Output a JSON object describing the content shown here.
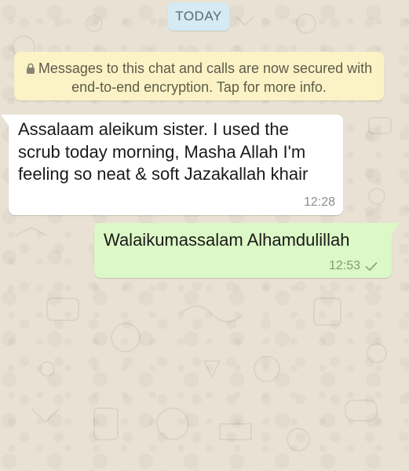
{
  "chat": {
    "date_label": "TODAY",
    "system_message": "Messages to this chat and calls are now secured with end-to-end encryption. Tap for more info.",
    "messages": [
      {
        "direction": "incoming",
        "text": "Assalaam aleikum sister. I used the scrub today morning, Masha Allah I'm feeling so neat & soft Jazakallah khair",
        "time": "12:28"
      },
      {
        "direction": "outgoing",
        "text": "Walaikumassalam Alhamdulillah",
        "time": "12:53",
        "status_icon": "single-check-icon"
      }
    ]
  },
  "colors": {
    "background": "#e9e2d4",
    "incoming_bubble": "#ffffff",
    "outgoing_bubble": "#dcf8c6",
    "system_bubble": "#fbf3c5",
    "date_chip": "#d4eaf4"
  },
  "icons": {
    "system_message": "lock-icon"
  }
}
